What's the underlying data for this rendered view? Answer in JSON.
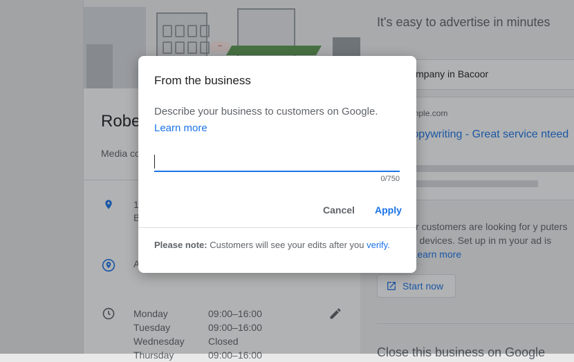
{
  "business": {
    "name": "Robe",
    "category": "Media co",
    "address_line1": "1",
    "address_line2": "B",
    "service_area_initial": "A"
  },
  "hours": [
    {
      "day": "Monday",
      "time": "09:00–16:00"
    },
    {
      "day": "Tuesday",
      "time": "09:00–16:00"
    },
    {
      "day": "Wednesday",
      "time": "Closed"
    },
    {
      "day": "Thursday",
      "time": "09:00–16:00"
    }
  ],
  "right_panel": {
    "title": "It's easy to advertise in minutes",
    "search_query": "edia company in Bacoor",
    "ad_url": "ww.example.com",
    "ad_headline": "ta's Copywriting - Great service nteed",
    "description": "whenever customers are looking for y puters or mobile devices. Set up in m your ad is clicked.",
    "learn_more": "Learn more",
    "start_now": "Start now",
    "close_heading": "Close this business on Google"
  },
  "dialog": {
    "title": "From the business",
    "description": "Describe your business to customers on Google.",
    "learn_more": "Learn more",
    "input_value": "",
    "counter": "0/750",
    "cancel": "Cancel",
    "apply": "Apply",
    "note_bold": "Please note:",
    "note_text": "Customers will see your edits after you",
    "note_link": "verify."
  },
  "colors": {
    "accent": "#1a73e8",
    "text_secondary": "#5f6368",
    "scrim": "rgba(32,33,36,0.35)"
  }
}
